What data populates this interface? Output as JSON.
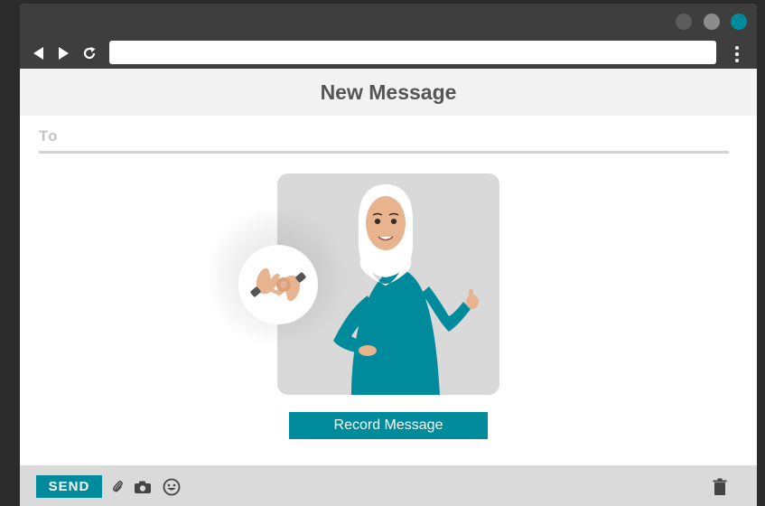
{
  "header": {
    "title": "New Message"
  },
  "recipient": {
    "label": "To",
    "value": ""
  },
  "address_bar": {
    "value": ""
  },
  "video": {
    "record_label": "Record Message"
  },
  "footer": {
    "send_label": "SEND"
  },
  "colors": {
    "accent": "#008b9c",
    "titlebar": "#3e3e3e",
    "header_bg": "#f2f2f2",
    "footer_bg": "#dadada",
    "card_bg": "#d9d9d9",
    "shirt": "#008b9c",
    "skin": "#e8b48f"
  },
  "icons": {
    "nav": [
      "back-arrow-icon",
      "forward-arrow-icon",
      "reload-icon",
      "more-vert-icon"
    ],
    "footer": [
      "paperclip-icon",
      "camera-icon",
      "emoji-icon",
      "trash-icon"
    ],
    "badge": "sign-language-hands-icon"
  }
}
